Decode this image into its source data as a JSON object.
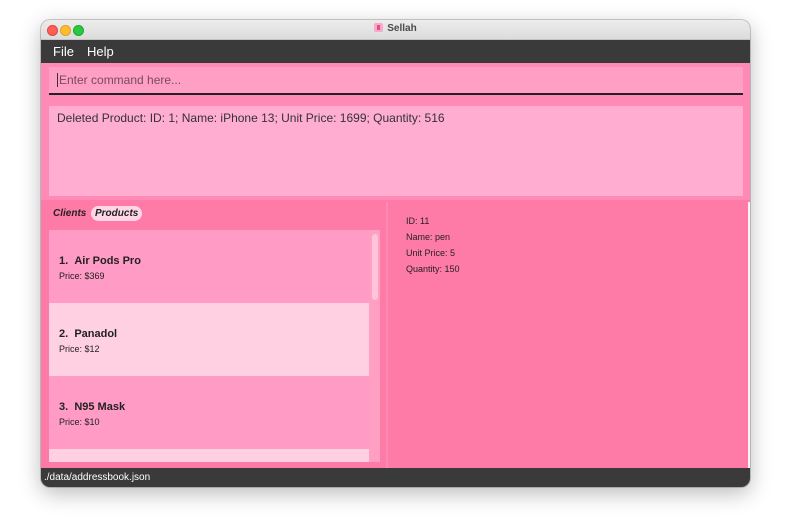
{
  "window": {
    "title": "Sellah"
  },
  "menu": {
    "file": "File",
    "help": "Help"
  },
  "command": {
    "placeholder": "Enter command here...",
    "value": ""
  },
  "result": {
    "text": "Deleted Product: ID: 1; Name: iPhone 13; Unit Price: 1699; Quantity: 516"
  },
  "tabs": {
    "clients": "Clients",
    "products": "Products",
    "selected": "Products"
  },
  "products": [
    {
      "index": "1.",
      "name": "Air Pods Pro",
      "price": "Price: $369"
    },
    {
      "index": "2.",
      "name": "Panadol",
      "price": "Price: $12"
    },
    {
      "index": "3.",
      "name": "N95 Mask",
      "price": "Price: $10"
    }
  ],
  "detail": {
    "id": "ID: 11",
    "name": "Name: pen",
    "unit_price": "Unit Price: 5",
    "quantity": "Quantity: 150"
  },
  "status": {
    "path": "./data/addressbook.json"
  },
  "colors": {
    "accent": "#ff7ba7",
    "menubar": "#3a3a3a",
    "card": "#ff9bc4",
    "card_selected": "#ffd0e2",
    "result_box": "#ffadd0"
  }
}
